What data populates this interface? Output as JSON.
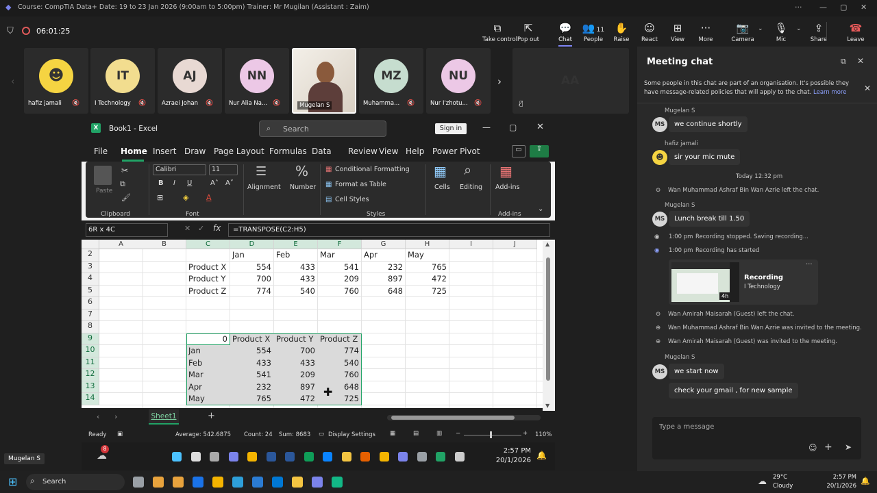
{
  "window": {
    "title": "Course: CompTIA Data+ Date: 19 to 23 Jan 2026 (9:00am to 5:00pm) Trainer: Mr Mugilan (Assistant : Zaim)"
  },
  "meeting": {
    "timer": "06:01:25",
    "toolbar": [
      {
        "label": "Take control",
        "icon": "take-control-icon"
      },
      {
        "label": "Pop out",
        "icon": "pop-out-icon"
      },
      {
        "label": "Chat",
        "icon": "chat-icon"
      },
      {
        "label": "People",
        "icon": "people-icon",
        "count": "11"
      },
      {
        "label": "Raise",
        "icon": "raise-hand-icon"
      },
      {
        "label": "React",
        "icon": "react-icon"
      },
      {
        "label": "View",
        "icon": "view-icon"
      },
      {
        "label": "More",
        "icon": "more-icon"
      },
      {
        "label": "Camera",
        "icon": "camera-off-icon"
      },
      {
        "label": "Mic",
        "icon": "mic-off-icon"
      },
      {
        "label": "Share",
        "icon": "share-icon"
      },
      {
        "label": "Leave",
        "icon": "leave-icon"
      }
    ],
    "participants": [
      {
        "name": "hafiz jamali",
        "initials": "",
        "color": "#f5d442"
      },
      {
        "name": "I Technology",
        "initials": "IT",
        "color": "#f2dd8f"
      },
      {
        "name": "Azraei Johan",
        "initials": "AJ",
        "color": "#e8d9d3"
      },
      {
        "name": "Nur Alia Na...",
        "initials": "NN",
        "color": "#ecc8e6"
      },
      {
        "name": "Mugelan S",
        "initials": "",
        "color": "#c9a98a"
      },
      {
        "name": "Muhamma...",
        "initials": "MZ",
        "color": "#c6ddcf"
      },
      {
        "name": "Nur I'zhotu...",
        "initials": "NU",
        "color": "#ecc8e6"
      }
    ],
    "extra_participant": {
      "initials": "AA",
      "color": "#d7ddf0"
    },
    "speaker_label": "Mugelan S"
  },
  "excel": {
    "title": "Book1 - Excel",
    "search_placeholder": "Search",
    "signin": "Sign in",
    "tabs": [
      "File",
      "Home",
      "Insert",
      "Draw",
      "Page Layout",
      "Formulas",
      "Data",
      "Review",
      "View",
      "Help",
      "Power Pivot"
    ],
    "ribbon": {
      "paste": "Paste",
      "font_name": "Calibri",
      "font_size": "11",
      "alignment": "Alignment",
      "number": "Number",
      "conditional": "Conditional Formatting",
      "format_table": "Format as Table",
      "cell_styles": "Cell Styles",
      "cells": "Cells",
      "editing": "Editing",
      "addins": "Add-ins",
      "groups": {
        "clipboard": "Clipboard",
        "font": "Font",
        "styles": "Styles",
        "addins": "Add-ins"
      }
    },
    "namebox": "6R x 4C",
    "formula": "=TRANSPOSE(C2:H5)",
    "columns": [
      "A",
      "B",
      "C",
      "D",
      "E",
      "F",
      "G",
      "H",
      "I",
      "J"
    ],
    "rows": [
      "2",
      "3",
      "4",
      "5",
      "6",
      "7",
      "8",
      "9",
      "10",
      "11",
      "12",
      "13",
      "14"
    ],
    "table1": {
      "header": [
        "Jan",
        "Feb",
        "Mar",
        "Apr",
        "May"
      ],
      "rows": [
        {
          "label": "Product X",
          "values": [
            "554",
            "433",
            "541",
            "232",
            "765"
          ]
        },
        {
          "label": "Product Y",
          "values": [
            "700",
            "433",
            "209",
            "897",
            "472"
          ]
        },
        {
          "label": "Product Z",
          "values": [
            "774",
            "540",
            "760",
            "648",
            "725"
          ]
        }
      ]
    },
    "table2": {
      "corner": "0",
      "header": [
        "Product X",
        "Product Y",
        "Product Z"
      ],
      "rows": [
        {
          "label": "Jan",
          "values": [
            "554",
            "700",
            "774"
          ]
        },
        {
          "label": "Feb",
          "values": [
            "433",
            "433",
            "540"
          ]
        },
        {
          "label": "Mar",
          "values": [
            "541",
            "209",
            "760"
          ]
        },
        {
          "label": "Apr",
          "values": [
            "232",
            "897",
            "648"
          ]
        },
        {
          "label": "May",
          "values": [
            "765",
            "472",
            "725"
          ]
        }
      ]
    },
    "sheet_tab": "Sheet1",
    "status": {
      "ready": "Ready",
      "average": "Average: 542.6875",
      "count": "Count: 24",
      "sum": "Sum: 8683",
      "display": "Display Settings",
      "zoom": "110%"
    },
    "inner_taskbar": {
      "badge": "8",
      "time": "2:57 PM",
      "date": "20/1/2026"
    }
  },
  "chat": {
    "title": "Meeting chat",
    "notice": "Some people in this chat are part of an organisation. It's possible they have message-related policies that will apply to the chat.",
    "learn_more": "Learn more",
    "messages": [
      {
        "sender": "Mugelan S",
        "initials": "MS",
        "text": "we continue shortly"
      },
      {
        "sender": "hafiz jamali",
        "initials": "",
        "text": "sir your mic mute"
      }
    ],
    "time_divider": "Today 12:32 pm",
    "sys1": "Wan Muhammad Ashraf Bin Wan Azrie left the chat.",
    "msg3": {
      "sender": "Mugelan S",
      "initials": "MS",
      "text": "Lunch break till 1.50"
    },
    "rec_events": [
      {
        "time": "1:00 pm",
        "text": "Recording stopped. Saving recording..."
      },
      {
        "time": "1:00 pm",
        "text": "Recording has started"
      }
    ],
    "recording_card": {
      "title": "Recording",
      "subtitle": "I Technology",
      "duration": "4h"
    },
    "sys_events": [
      "Wan Amirah Maisarah (Guest) left the chat.",
      "Wan Muhammad Ashraf Bin Wan Azrie was invited to the meeting.",
      "Wan Amirah Maisarah (Guest) was invited to the meeting."
    ],
    "msg4": {
      "sender": "Mugelan S",
      "initials": "MS",
      "text": "we start now",
      "text2": "check your gmail , for new sample"
    },
    "input_placeholder": "Type a message"
  },
  "taskbar": {
    "search": "Search",
    "weather_temp": "29°C",
    "weather_desc": "Cloudy",
    "time": "2:57 PM",
    "date": "20/1/2026"
  }
}
